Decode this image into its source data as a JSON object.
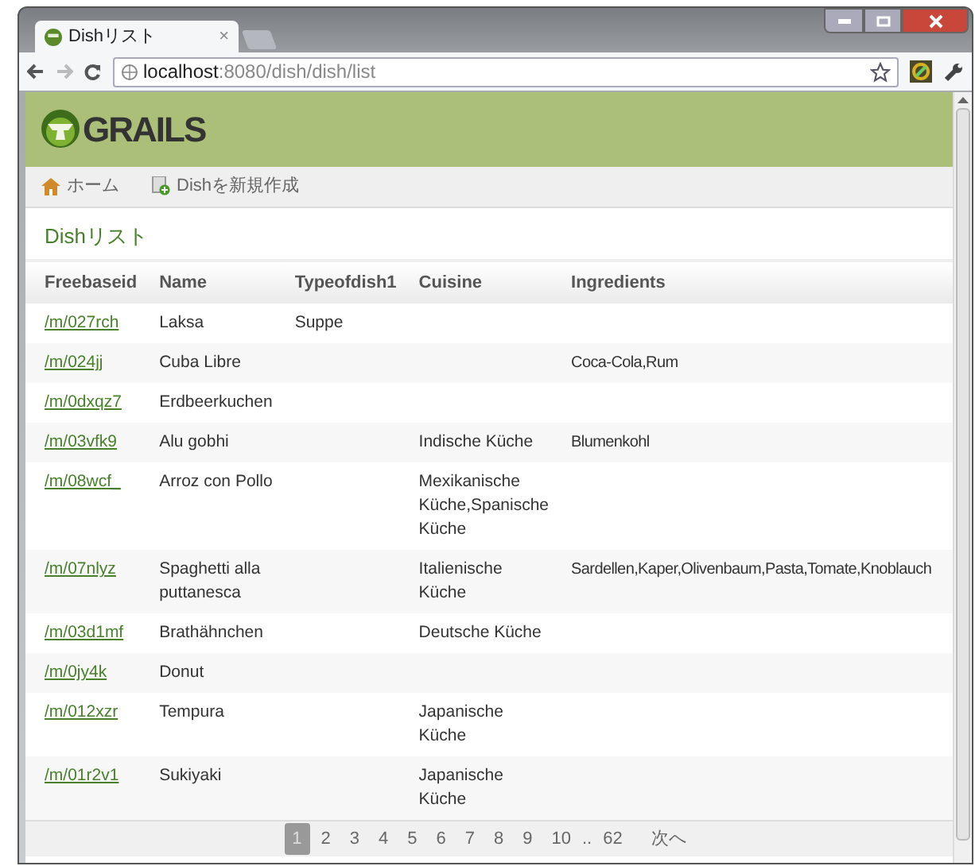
{
  "browser": {
    "tab_title": "Dishリスト",
    "tab_close": "×",
    "url_host": "localhost",
    "url_rest": ":8080/dish/dish/list"
  },
  "nav": [
    {
      "kind": "home",
      "label": "ホーム"
    },
    {
      "kind": "create",
      "label": "Dishを新規作成"
    }
  ],
  "logo": "GRAILS",
  "heading": "Dishリスト",
  "table": {
    "columns": [
      "Freebaseid",
      "Name",
      "Typeofdish1",
      "Cuisine",
      "Ingredients"
    ],
    "rows": [
      [
        "/m/027rch",
        "Laksa",
        "Suppe",
        "",
        ""
      ],
      [
        "/m/024jj",
        "Cuba Libre",
        "",
        "",
        "Coca-Cola,Rum"
      ],
      [
        "/m/0dxqz7",
        "Erdbeerkuchen",
        "",
        "",
        ""
      ],
      [
        "/m/03vfk9",
        "Alu gobhi",
        "",
        "Indische Küche",
        "Blumenkohl"
      ],
      [
        "/m/08wcf_",
        "Arroz con Pollo",
        "",
        "Mexikanische Küche,Spanische Küche",
        ""
      ],
      [
        "/m/07nlyz",
        "Spaghetti alla puttanesca",
        "",
        "Italienische Küche",
        "Sardellen,Kaper,Olivenbaum,Pasta,Tomate,Knoblauch"
      ],
      [
        "/m/03d1mf",
        "Brathähnchen",
        "",
        "Deutsche Küche",
        ""
      ],
      [
        "/m/0jy4k",
        "Donut",
        "",
        "",
        ""
      ],
      [
        "/m/012xzr",
        "Tempura",
        "",
        "Japanische Küche",
        ""
      ],
      [
        "/m/01r2v1",
        "Sukiyaki",
        "",
        "Japanische Küche",
        ""
      ]
    ]
  },
  "pagination": {
    "pages": [
      {
        "label": "1",
        "selected": true
      },
      {
        "label": "2",
        "selected": false
      },
      {
        "label": "3",
        "selected": false
      },
      {
        "label": "4",
        "selected": false
      },
      {
        "label": "5",
        "selected": false
      },
      {
        "label": "6",
        "selected": false
      },
      {
        "label": "7",
        "selected": false
      },
      {
        "label": "8",
        "selected": false
      },
      {
        "label": "9",
        "selected": false
      },
      {
        "label": "10",
        "selected": false
      }
    ],
    "gap": "..",
    "last": "62",
    "next": "次へ"
  }
}
